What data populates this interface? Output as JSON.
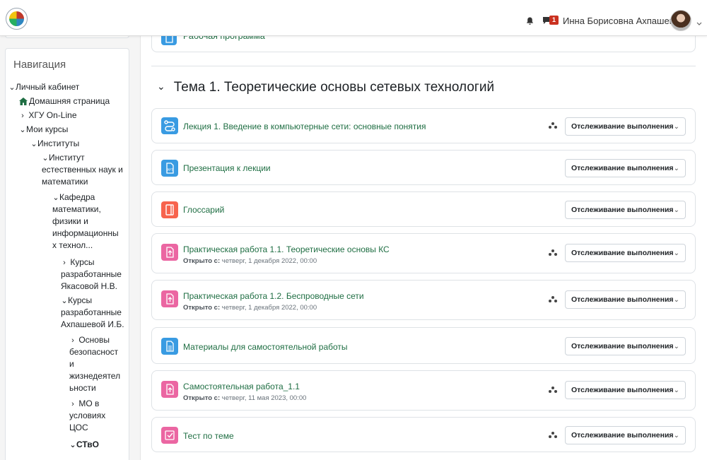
{
  "topbar": {
    "user_name": "Инна Борисовна Ахпашева",
    "message_count": "1"
  },
  "navigation": {
    "heading": "Навигация",
    "items": [
      "Личный кабинет",
      "Домашняя страница",
      "ХГУ On-Line",
      "Мои курсы",
      "Институты",
      "Институт",
      "естественных наук и",
      "математики",
      "Кафедра",
      "математики,",
      "физики и",
      "информационны",
      "х технол...",
      "Курсы",
      "разработанные",
      "Якасовой Н.В.",
      "Курсы",
      "разработанные",
      "Ахпашевой И.Б.",
      "Основы",
      "безопасност",
      "и",
      "жизнедеятел",
      "ьности",
      "МО в",
      "условиях",
      "ЦОС",
      "СТвО"
    ]
  },
  "course": {
    "previous_activity": "Рабочая программа",
    "section_title": "Тема 1. Теоретические основы сетевых технологий",
    "completion_label": "Отслеживание выполнения",
    "opened_label": "Открыто с:",
    "activities": [
      {
        "title": "Лекция 1. Введение в компьютерные сети: основные понятия",
        "type": "lesson",
        "icon": "lesson-icon",
        "color": "#399be2"
      },
      {
        "title": "Презентация к лекции",
        "type": "file",
        "icon": "file-icon",
        "color": "#399be2"
      },
      {
        "title": "Глоссарий",
        "type": "glossary",
        "icon": "glossary-icon",
        "color": "#f7634d"
      },
      {
        "title": "Практическая работа 1.1. Теоретические основы КС",
        "type": "assignment",
        "icon": "assignment-icon",
        "color": "#eb66a2",
        "opened": "четверг, 1 декабря 2022, 00:00"
      },
      {
        "title": "Практическая работа 1.2. Беспроводные сети",
        "type": "assignment",
        "icon": "assignment-icon",
        "color": "#eb66a2",
        "opened": "четверг, 1 декабря 2022, 00:00"
      },
      {
        "title": "Материалы для самостоятельной работы",
        "type": "page",
        "icon": "page-icon",
        "color": "#399be2"
      },
      {
        "title": "Самостоятельная работа_1.1",
        "type": "assignment",
        "icon": "assignment-icon",
        "color": "#eb66a2",
        "opened": "четверг, 11 мая 2023, 00:00"
      },
      {
        "title": "Тест по теме",
        "type": "quiz",
        "icon": "quiz-icon",
        "color": "#eb66a2"
      }
    ]
  },
  "colors": {
    "link": "#1f6e43",
    "badge": "#ca3120",
    "border": "#dee2e6"
  }
}
